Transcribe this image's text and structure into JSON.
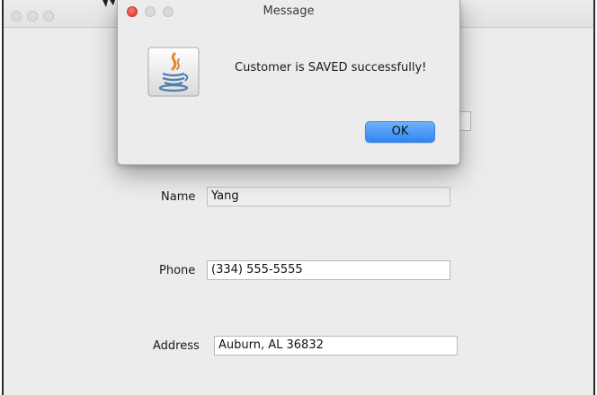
{
  "dialog": {
    "title": "Message",
    "message": "Customer is SAVED successfully!",
    "ok_label": "OK",
    "icon": "java-coffee-cup-icon"
  },
  "form": {
    "name_label": "Name",
    "name_value": "Yang",
    "phone_label": "Phone",
    "phone_value": "(334) 555-5555",
    "address_label": "Address",
    "address_value": "Auburn, AL 36832"
  },
  "colors": {
    "window_bg": "#ececec",
    "accent_button": "#2d86f4",
    "close_light": "#e5473b"
  }
}
